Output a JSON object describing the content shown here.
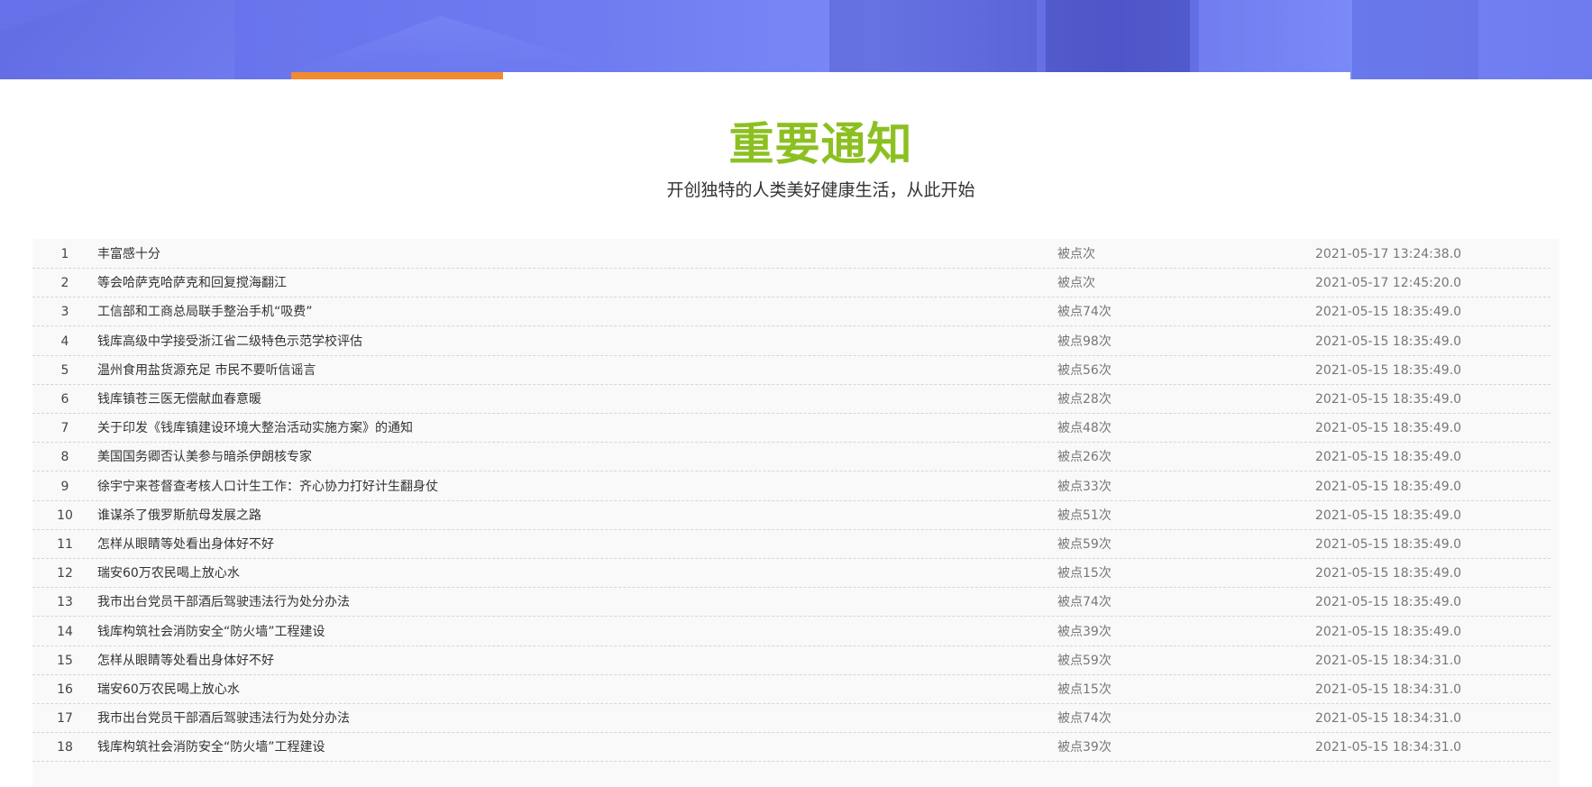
{
  "header": {
    "title": "重要通知",
    "subtitle": "开创独特的人类美好健康生活，从此开始"
  },
  "colors": {
    "title": "#8cc021",
    "tab_active": "#f28a30",
    "banner": "#6d7af0"
  },
  "notices": [
    {
      "index": "1",
      "title": "丰富感十分",
      "clicks": "被点次",
      "date": "2021-05-17 13:24:38.0"
    },
    {
      "index": "2",
      "title": "等会哈萨克哈萨克和回复搅海翻江",
      "clicks": "被点次",
      "date": "2021-05-17 12:45:20.0"
    },
    {
      "index": "3",
      "title": "工信部和工商总局联手整治手机“吸费”",
      "clicks": "被点74次",
      "date": "2021-05-15 18:35:49.0"
    },
    {
      "index": "4",
      "title": "钱库高级中学接受浙江省二级特色示范学校评估",
      "clicks": "被点98次",
      "date": "2021-05-15 18:35:49.0"
    },
    {
      "index": "5",
      "title": "温州食用盐货源充足 市民不要听信谣言",
      "clicks": "被点56次",
      "date": "2021-05-15 18:35:49.0"
    },
    {
      "index": "6",
      "title": "钱库镇苍三医无偿献血春意暖",
      "clicks": "被点28次",
      "date": "2021-05-15 18:35:49.0"
    },
    {
      "index": "7",
      "title": "关于印发《钱库镇建设环境大整治活动实施方案》的通知",
      "clicks": "被点48次",
      "date": "2021-05-15 18:35:49.0"
    },
    {
      "index": "8",
      "title": "美国国务卿否认美参与暗杀伊朗核专家",
      "clicks": "被点26次",
      "date": "2021-05-15 18:35:49.0"
    },
    {
      "index": "9",
      "title": "徐宇宁来苍督查考核人口计生工作：齐心协力打好计生翻身仗",
      "clicks": "被点33次",
      "date": "2021-05-15 18:35:49.0"
    },
    {
      "index": "10",
      "title": "谁谋杀了俄罗斯航母发展之路",
      "clicks": "被点51次",
      "date": "2021-05-15 18:35:49.0"
    },
    {
      "index": "11",
      "title": "怎样从眼睛等处看出身体好不好",
      "clicks": "被点59次",
      "date": "2021-05-15 18:35:49.0"
    },
    {
      "index": "12",
      "title": "瑞安60万农民喝上放心水",
      "clicks": "被点15次",
      "date": "2021-05-15 18:35:49.0"
    },
    {
      "index": "13",
      "title": "我市出台党员干部酒后驾驶违法行为处分办法",
      "clicks": "被点74次",
      "date": "2021-05-15 18:35:49.0"
    },
    {
      "index": "14",
      "title": "钱库构筑社会消防安全“防火墙”工程建设",
      "clicks": "被点39次",
      "date": "2021-05-15 18:35:49.0"
    },
    {
      "index": "15",
      "title": "怎样从眼睛等处看出身体好不好",
      "clicks": "被点59次",
      "date": "2021-05-15 18:34:31.0"
    },
    {
      "index": "16",
      "title": "瑞安60万农民喝上放心水",
      "clicks": "被点15次",
      "date": "2021-05-15 18:34:31.0"
    },
    {
      "index": "17",
      "title": "我市出台党员干部酒后驾驶违法行为处分办法",
      "clicks": "被点74次",
      "date": "2021-05-15 18:34:31.0"
    },
    {
      "index": "18",
      "title": "钱库构筑社会消防安全“防火墙”工程建设",
      "clicks": "被点39次",
      "date": "2021-05-15 18:34:31.0"
    }
  ]
}
